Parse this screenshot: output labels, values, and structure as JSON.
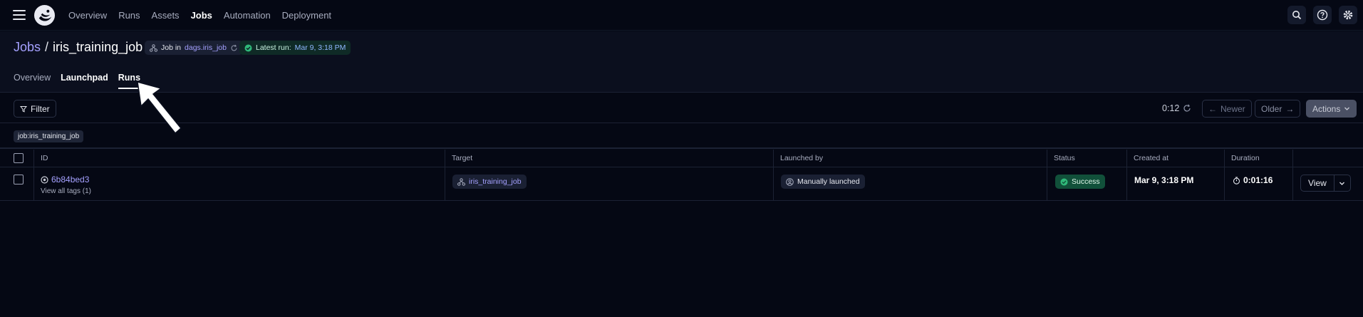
{
  "nav": {
    "links": [
      "Overview",
      "Runs",
      "Assets",
      "Jobs",
      "Automation",
      "Deployment"
    ],
    "active": "Jobs",
    "icons": [
      "search-icon",
      "help-icon",
      "gear-icon"
    ]
  },
  "header": {
    "crumb": "Jobs",
    "separator": "/",
    "job_name": "iris_training_job",
    "job_pill_prefix": "Job in",
    "job_pill_link": "dags.iris_job",
    "latest_prefix": "Latest run:",
    "latest_value": "Mar 9, 3:18 PM",
    "tabs": [
      "Overview",
      "Launchpad",
      "Runs"
    ],
    "active_tab": "Runs"
  },
  "toolbar": {
    "filter_label": "Filter",
    "refresh_timer": "0:12",
    "newer_label": "Newer",
    "older_label": "Older",
    "actions_label": "Actions"
  },
  "filter_tag": "job:iris_training_job",
  "table": {
    "columns": [
      "ID",
      "Target",
      "Launched by",
      "Status",
      "Created at",
      "Duration"
    ],
    "rows": [
      {
        "id": "6b84bed3",
        "tags_link": "View all tags (1)",
        "target": "iris_training_job",
        "launched_by": "Manually launched",
        "status": "Success",
        "created_at": "Mar 9, 3:18 PM",
        "duration": "0:01:16",
        "view_label": "View"
      }
    ]
  },
  "colors": {
    "background": "#050814",
    "header_bg": "#0b0f1e",
    "accent_link": "#a5a1ff",
    "success": "#11503a"
  }
}
